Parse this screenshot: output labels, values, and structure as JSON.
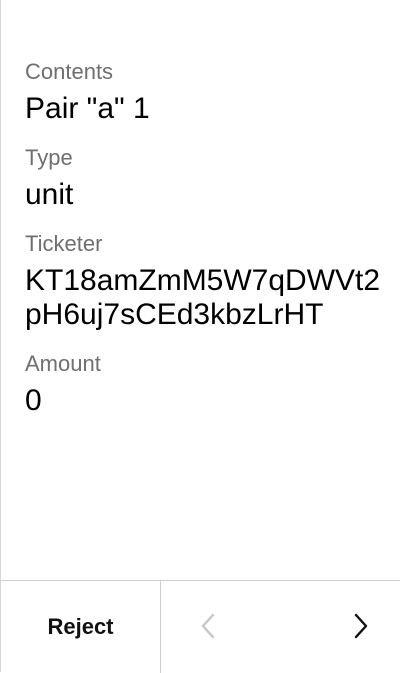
{
  "contents": {
    "label": "Contents",
    "value": "Pair \"a\" 1"
  },
  "type": {
    "label": "Type",
    "value": "unit"
  },
  "ticketer": {
    "label": "Ticketer",
    "value": "KT18amZmM5W7qDWVt2pH6uj7sCEd3kbzLrHT"
  },
  "amount": {
    "label": "Amount",
    "value": "0"
  },
  "footer": {
    "reject_label": "Reject",
    "previous_icon": "chevron-left-icon",
    "next_icon": "chevron-right-icon",
    "previous_color": "#c7c7c7",
    "next_color": "#111111"
  }
}
